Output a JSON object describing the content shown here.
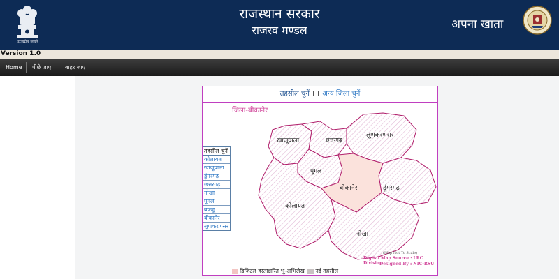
{
  "header": {
    "title_line1": "राजस्थान सरकार",
    "title_line2": "राजस्व मण्डल",
    "right_title": "अपना खाता",
    "motto": "सत्यमेव जयते",
    "emblem_icon": "state-emblem-icon",
    "seal_icon": "board-seal-icon",
    "bg_color": "#0d2b55"
  },
  "version": "Version 1.0",
  "nav": [
    "Home",
    "पीछे जाए",
    "बाहर जाए"
  ],
  "panel": {
    "select_tehsil": "तहसील चुनें",
    "other_district": "अन्य जिला चुनें",
    "district_label": "जिला-बीकानेर",
    "tehsil_list_header": "तहसील चुनें",
    "tehsils": [
      "कोलायत",
      "खाजूवाला",
      "डुंगरगढ़",
      "छत्तरगढ़",
      "नोखा",
      "पूगल",
      "बज्जू",
      "बीकानेर",
      "लूणकरणसर"
    ],
    "map_regions": [
      "खाजूवाला",
      "छत्तरगढ़",
      "लूणकरणसर",
      "पूगल",
      "बीकानेर",
      "डूंगरगढ़",
      "कोलायत",
      "नोखा"
    ],
    "highlighted_region": "बीकानेर",
    "map_not_to_scale": "(Map Not To Scale)",
    "map_source": "Digital Map Source : LRC Division",
    "designed_by": "Designed By : NIC-RSU",
    "legend_digital": "डिजिटल हस्ताक्षरित भू-अभिलेख",
    "legend_new": "नई तहसील",
    "border_color": "#c03fc0",
    "accent_pink": "#d1489b",
    "highlight_color": "#f9d9d6"
  }
}
